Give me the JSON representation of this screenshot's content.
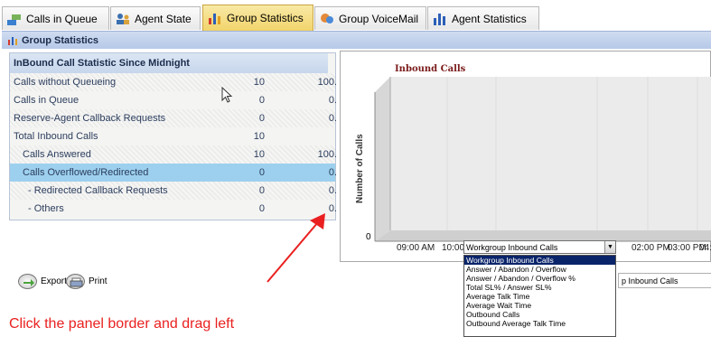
{
  "tabs": [
    {
      "label": "Calls in Queue",
      "icon": "phone-queue-icon"
    },
    {
      "label": "Agent State",
      "icon": "agents-icon"
    },
    {
      "label": "Group Statistics",
      "icon": "bar-chart-icon",
      "active": true
    },
    {
      "label": "Group VoiceMail",
      "icon": "voicemail-icon"
    },
    {
      "label": "Agent Statistics",
      "icon": "bar-chart-icon"
    }
  ],
  "panel_title": "Group Statistics",
  "stats": {
    "header": "InBound Call Statistic Since Midnight",
    "rows": [
      {
        "label": "Calls without Queueing",
        "v1": "10",
        "v2": "100."
      },
      {
        "label": "Calls in Queue",
        "v1": "0",
        "v2": "0."
      },
      {
        "label": "Reserve-Agent Callback Requests",
        "v1": "0",
        "v2": "0."
      },
      {
        "label": "Total Inbound Calls",
        "v1": "10",
        "v2": ""
      },
      {
        "label": "Calls Answered",
        "v1": "10",
        "v2": "100."
      },
      {
        "label": "Calls Overflowed/Redirected",
        "v1": "0",
        "v2": "0."
      },
      {
        "label": "- Redirected Callback Requests",
        "v1": "0",
        "v2": "0."
      },
      {
        "label": "- Others",
        "v1": "0",
        "v2": "0."
      }
    ]
  },
  "chart": {
    "title": "Inbound Calls",
    "ylabel": "Number of Calls",
    "zero_label": "0",
    "xticks_left": [
      "09:00 AM",
      "10:00"
    ],
    "xticks_right": [
      "02:00 PM",
      "03:00 PM",
      "04:"
    ]
  },
  "dropdown": {
    "selected": "Workgroup Inbound Calls",
    "options": [
      "Workgroup Inbound Calls",
      "Answer / Abandon / Overflow",
      "Answer / Abandon / Overflow %",
      "Total SL% / Answer SL%",
      "Average Talk Time",
      "Average Wait Time",
      "Outbound Calls",
      "Outbound Average Talk Time"
    ]
  },
  "behind_combo_text": "p Inbound Calls",
  "buttons": {
    "export": "Export",
    "print": "Print"
  },
  "instruction": "Click the panel border and drag left",
  "colors": {
    "instruction": "#ea2020",
    "selected_row": "#9dd0ee",
    "active_tab": "#f2d46a",
    "chart_title": "#7a1a1a",
    "selected_option": "#0a246a"
  }
}
